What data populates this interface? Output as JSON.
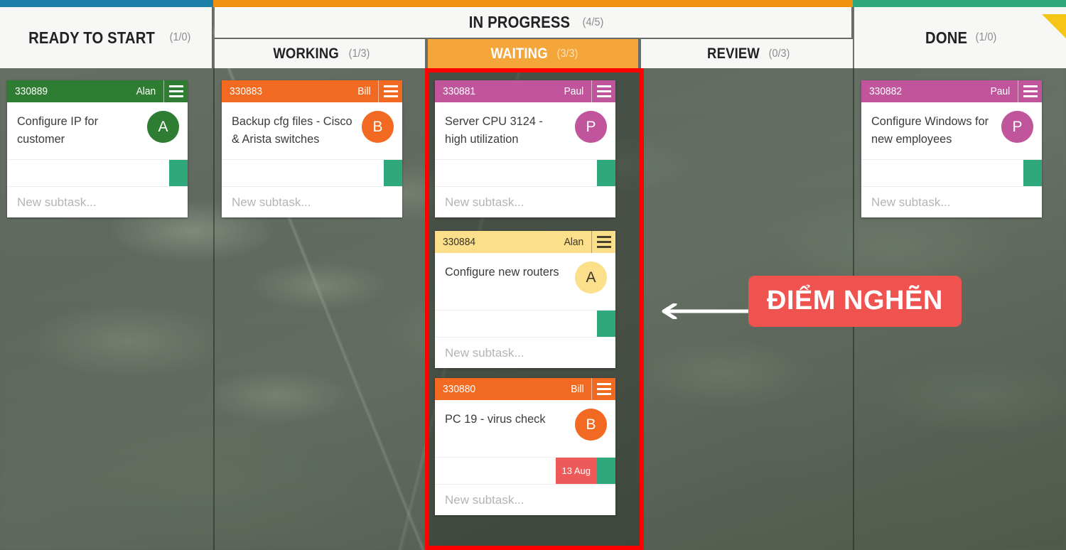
{
  "board": {
    "columns": [
      {
        "name": "ready-to-start",
        "title": "READY TO START",
        "count": "(1/0)",
        "accent": "#1b7fa8"
      },
      {
        "name": "in-progress",
        "title": "IN PROGRESS",
        "count": "(4/5)",
        "accent": "#f0920f"
      },
      {
        "name": "done",
        "title": "DONE",
        "count": "(1/0)",
        "accent": "#2fa97b"
      }
    ],
    "subcolumns": [
      {
        "name": "working",
        "title": "WORKING",
        "count": "(1/3)",
        "active": false
      },
      {
        "name": "waiting",
        "title": "WAITING",
        "count": "(3/3)",
        "active": true
      },
      {
        "name": "review",
        "title": "REVIEW",
        "count": "(0/3)",
        "active": false
      }
    ]
  },
  "cards": [
    {
      "column": "ready-to-start",
      "id": "330889",
      "owner": "Alan",
      "title": "Configure IP for customer",
      "avatar_letter": "A",
      "color": "#2e7d32",
      "avatar_color": "#2e7d32",
      "light_header": false,
      "due": null,
      "subtask_placeholder": "New subtask..."
    },
    {
      "column": "working",
      "id": "330883",
      "owner": "Bill",
      "title": "Backup cfg files - Cisco & Arista switches",
      "avatar_letter": "B",
      "color": "#f26a21",
      "avatar_color": "#f26a21",
      "light_header": false,
      "due": null,
      "subtask_placeholder": "New subtask..."
    },
    {
      "column": "waiting",
      "id": "330881",
      "owner": "Paul",
      "title": "Server CPU 3124 - high utilization",
      "avatar_letter": "P",
      "color": "#c0559c",
      "avatar_color": "#c0559c",
      "light_header": false,
      "due": null,
      "subtask_placeholder": "New subtask..."
    },
    {
      "column": "waiting",
      "id": "330884",
      "owner": "Alan",
      "title": "Configure new routers",
      "avatar_letter": "A",
      "color": "#fbdf8a",
      "avatar_color": "#fbdf8a",
      "light_header": true,
      "due": null,
      "subtask_placeholder": "New subtask..."
    },
    {
      "column": "waiting",
      "id": "330880",
      "owner": "Bill",
      "title": "PC 19 - virus check",
      "avatar_letter": "B",
      "color": "#f26a21",
      "avatar_color": "#f26a21",
      "light_header": false,
      "due": "13 Aug",
      "subtask_placeholder": "New subtask..."
    },
    {
      "column": "done",
      "id": "330882",
      "owner": "Paul",
      "title": "Configure Windows for new employees",
      "avatar_letter": "P",
      "color": "#c0559c",
      "avatar_color": "#c0559c",
      "light_header": false,
      "due": null,
      "subtask_placeholder": "New subtask..."
    }
  ],
  "annotation": {
    "label": "ĐIỂM NGHẼN",
    "badge_color": "#ef5350",
    "arrow_direction": "left"
  },
  "highlight": {
    "target_column": "waiting",
    "border_color": "#ff0000"
  }
}
